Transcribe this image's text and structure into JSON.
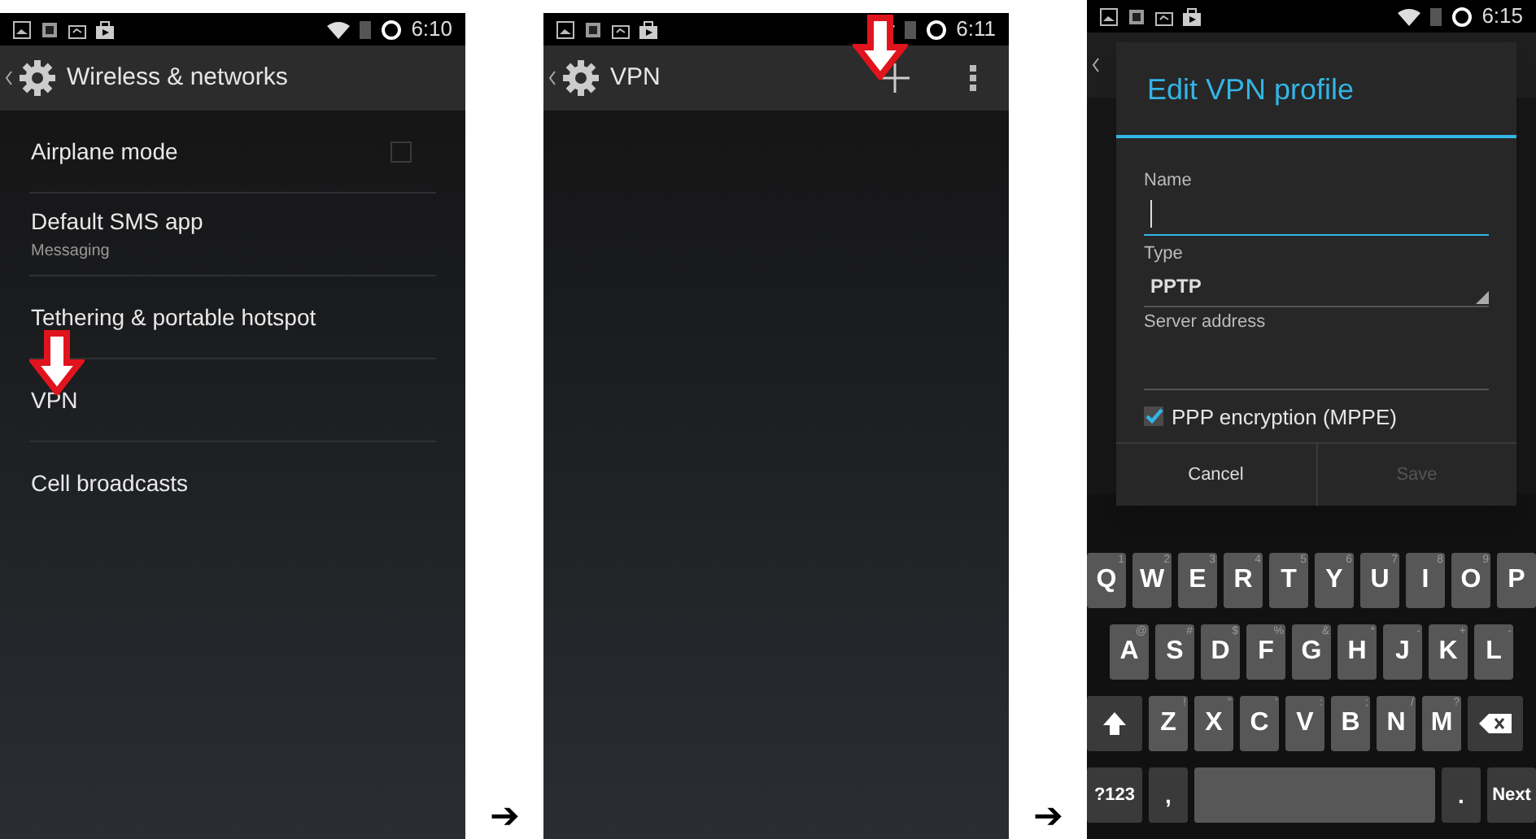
{
  "screens": [
    {
      "kind": "settings",
      "status_bar": {
        "time": "6:10"
      },
      "title": "Wireless & networks",
      "items": [
        {
          "kind": "checkbox",
          "label": "Airplane mode",
          "checked": false,
          "pointed": false
        },
        {
          "kind": "text",
          "label": "Default SMS app",
          "summary": "Messaging",
          "pointed": false
        },
        {
          "kind": "text",
          "label": "Tethering & portable hotspot",
          "pointed": false
        },
        {
          "kind": "text",
          "label": "VPN",
          "pointed": true
        },
        {
          "kind": "text",
          "label": "Cell broadcasts",
          "pointed": false
        }
      ]
    },
    {
      "kind": "vpn",
      "status_bar": {
        "time": "6:11"
      },
      "title": "VPN",
      "add_pointed": true
    },
    {
      "kind": "dialog",
      "status_bar": {
        "time": "6:15"
      },
      "dialog": {
        "title": "Edit VPN profile",
        "fields": [
          {
            "kind": "text",
            "label": "Name",
            "focused": true
          },
          {
            "kind": "select",
            "label": "Type",
            "value": "PPTP",
            "focused": false
          },
          {
            "kind": "text",
            "label": "Server address",
            "focused": false
          }
        ],
        "checkbox": {
          "label": "PPP encryption (MPPE)",
          "checked": true
        },
        "buttons": [
          {
            "label": "Cancel",
            "disabled": false
          },
          {
            "label": "Save",
            "disabled": true
          }
        ]
      },
      "keyboard": {
        "rows": [
          {
            "keys": [
              {
                "kind": "letter",
                "label": "Q",
                "hint": "1"
              },
              {
                "kind": "letter",
                "label": "W",
                "hint": "2"
              },
              {
                "kind": "letter",
                "label": "E",
                "hint": "3"
              },
              {
                "kind": "letter",
                "label": "R",
                "hint": "4"
              },
              {
                "kind": "letter",
                "label": "T",
                "hint": "5"
              },
              {
                "kind": "letter",
                "label": "Y",
                "hint": "6"
              },
              {
                "kind": "letter",
                "label": "U",
                "hint": "7"
              },
              {
                "kind": "letter",
                "label": "I",
                "hint": "8"
              },
              {
                "kind": "letter",
                "label": "O",
                "hint": "9"
              },
              {
                "kind": "letter",
                "label": "P"
              }
            ]
          },
          {
            "keys": [
              {
                "kind": "letter",
                "label": "A",
                "hint": "@"
              },
              {
                "kind": "letter",
                "label": "S",
                "hint": "#"
              },
              {
                "kind": "letter",
                "label": "D",
                "hint": "$"
              },
              {
                "kind": "letter",
                "label": "F",
                "hint": "%"
              },
              {
                "kind": "letter",
                "label": "G",
                "hint": "&"
              },
              {
                "kind": "letter",
                "label": "H",
                "hint": "*"
              },
              {
                "kind": "letter",
                "label": "J",
                "hint": "-"
              },
              {
                "kind": "letter",
                "label": "K",
                "hint": "+"
              },
              {
                "kind": "letter",
                "label": "L",
                "hint": "-"
              }
            ]
          },
          {
            "keys": [
              {
                "kind": "shift"
              },
              {
                "kind": "letter",
                "label": "Z",
                "hint": "!"
              },
              {
                "kind": "letter",
                "label": "X",
                "hint": "\""
              },
              {
                "kind": "letter",
                "label": "C",
                "hint": "'"
              },
              {
                "kind": "letter",
                "label": "V",
                "hint": ":"
              },
              {
                "kind": "letter",
                "label": "B",
                "hint": ";"
              },
              {
                "kind": "letter",
                "label": "N",
                "hint": "/"
              },
              {
                "kind": "letter",
                "label": "M",
                "hint": "?"
              },
              {
                "kind": "backspace"
              }
            ]
          },
          {
            "keys": [
              {
                "kind": "symbols",
                "label": "?123"
              },
              {
                "kind": "comma",
                "label": ","
              },
              {
                "kind": "space"
              },
              {
                "kind": "period",
                "label": "."
              },
              {
                "kind": "action",
                "label": "Next"
              }
            ]
          }
        ]
      }
    }
  ],
  "flow_arrows": [
    "➔",
    "➔"
  ]
}
